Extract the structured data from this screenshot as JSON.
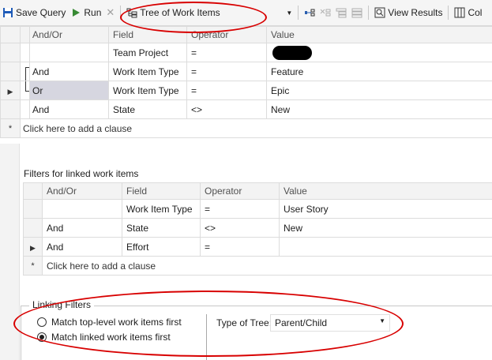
{
  "toolbar": {
    "save_label": "Save Query",
    "run_label": "Run",
    "tree_label": "Tree of Work Items",
    "view_results_label": "View Results",
    "column_options_label": "Col"
  },
  "main_query": {
    "headers": [
      "And/Or",
      "Field",
      "Operator",
      "Value"
    ],
    "rows": [
      {
        "andor": "",
        "field": "Team Project",
        "operator": "=",
        "value": ""
      },
      {
        "andor": "And",
        "field": "Work Item Type",
        "operator": "=",
        "value": "Feature"
      },
      {
        "andor": "Or",
        "field": "Work Item Type",
        "operator": "=",
        "value": "Epic"
      },
      {
        "andor": "And",
        "field": "State",
        "operator": "<>",
        "value": "New"
      }
    ],
    "add_clause": "Click here to add a clause"
  },
  "linked_query": {
    "title": "Filters for linked work items",
    "headers": [
      "And/Or",
      "Field",
      "Operator",
      "Value"
    ],
    "rows": [
      {
        "andor": "",
        "field": "Work Item Type",
        "operator": "=",
        "value": "User Story"
      },
      {
        "andor": "And",
        "field": "State",
        "operator": "<>",
        "value": "New"
      },
      {
        "andor": "And",
        "field": "Effort",
        "operator": "=",
        "value": ""
      }
    ],
    "add_clause": "Click here to add a clause"
  },
  "linking_filters": {
    "title": "Linking Filters",
    "option_top": "Match top-level work items first",
    "option_linked": "Match linked work items first",
    "selected": "option_linked",
    "tree_type_label": "Type of Tree:",
    "tree_type_value": "Parent/Child"
  },
  "colors": {
    "accent": "#1e1e1e",
    "run_green": "#388a34",
    "save_blue": "#1e5bb8",
    "annotation_red": "#d80000"
  },
  "icons": [
    "save-icon",
    "run-icon",
    "cancel-icon",
    "tree-icon",
    "dropdown-icon",
    "link-icon",
    "unlink-icon",
    "expand-icon",
    "collapse-icon",
    "view-results-icon",
    "column-options-icon",
    "row-pointer-icon",
    "new-row-icon"
  ]
}
